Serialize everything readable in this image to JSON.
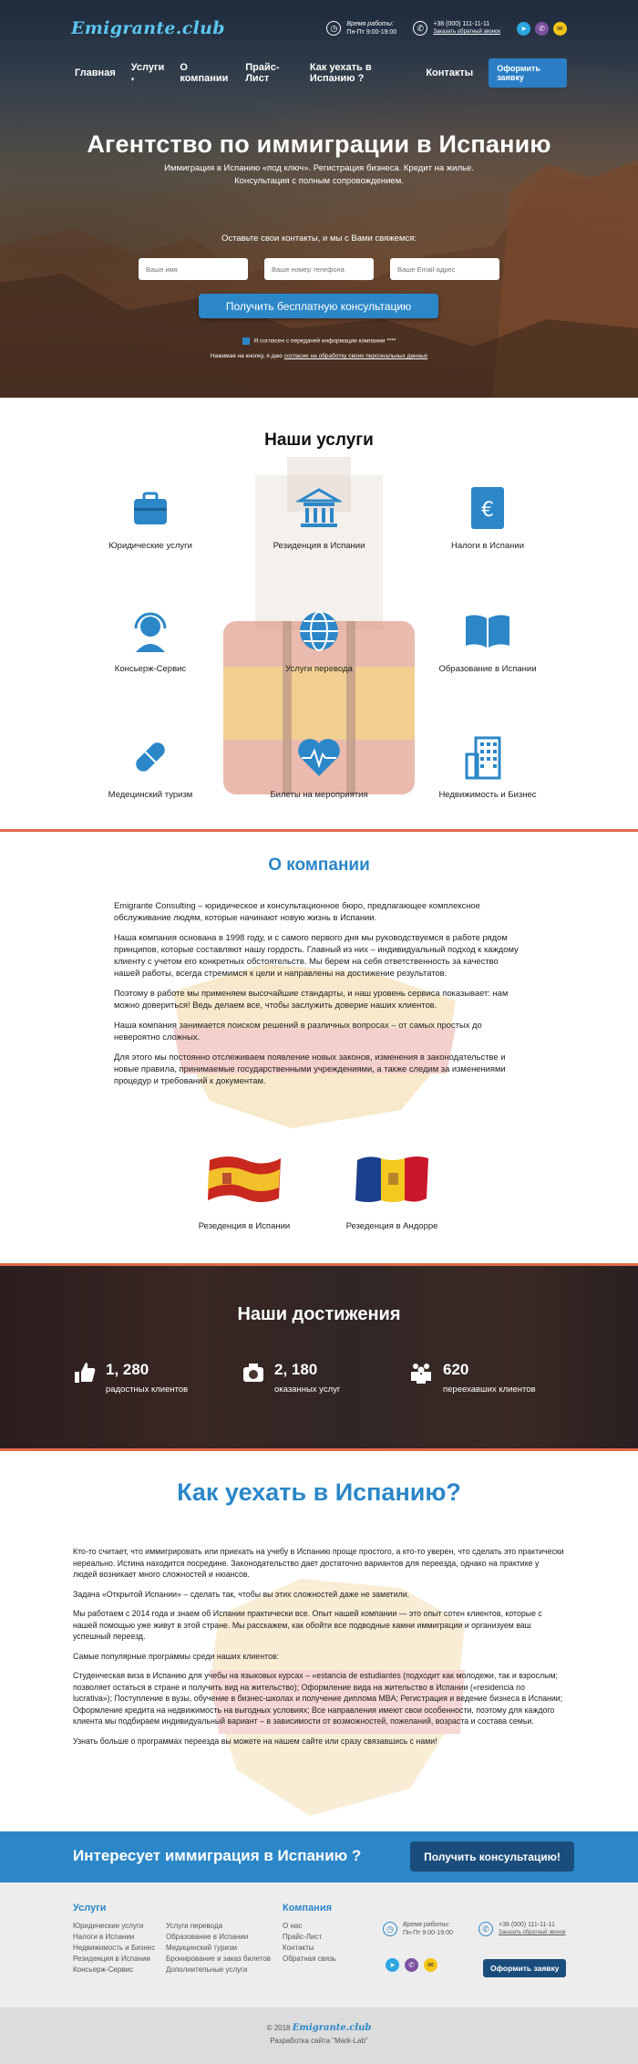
{
  "header": {
    "logo": "Emigrante.club",
    "hours_label": "Время работы:",
    "hours_value": "Пн-Пт 9:00-19:00",
    "phone": "+38 (000) 111-11-11",
    "callback": "Заказать обратный звонок",
    "nav": [
      "Главная",
      "Услуги",
      "О компании",
      "Прайс-Лист",
      "Как уехать в Испанию ?",
      "Контакты"
    ],
    "order_button": "Оформить заявку"
  },
  "hero": {
    "title": "Агентство по иммиграции в Испанию",
    "subtitle": "Иммиграция в Испанию «под ключ». Регистрация бизнеса. Кредит на жилье. Консультация с полным сопровождением.",
    "leave_contacts": "Оставьте свои контакты, и мы с Вами свяжемся:",
    "name_placeholder": "Ваше имя",
    "phone_placeholder": "Ваше номер телефона",
    "email_placeholder": "Ваше Email-адрес",
    "cta": "Получить бесплатную консультацию",
    "agree": "Я согласен с передачей информации компании ****",
    "agree2_prefix": "Нажимая на кнопку, я даю",
    "agree2_link": "согласие на обработку своих персональных данных"
  },
  "services": {
    "title": "Наши услуги",
    "items": [
      {
        "label": "Юридические услуги",
        "icon": "briefcase-icon"
      },
      {
        "label": "Резиденция в Испании",
        "icon": "building-icon"
      },
      {
        "label": "Налоги в Испании",
        "icon": "euro-doc-icon"
      },
      {
        "label": "Консьерж-Сервис",
        "icon": "headset-icon"
      },
      {
        "label": "Услуги перевода",
        "icon": "globe-icon"
      },
      {
        "label": "Образование в Испании",
        "icon": "book-icon"
      },
      {
        "label": "Медецинский туризм",
        "icon": "pill-icon"
      },
      {
        "label": "Билеты на мероприятия",
        "icon": "heartbeat-icon"
      },
      {
        "label": "Недвижимость и Бизнес",
        "icon": "office-icon"
      }
    ]
  },
  "about": {
    "title": "О компании",
    "paragraphs": [
      "Emigrante Consulting – юридическое и консультационное бюро, предлагающее комплексное обслуживание людям, которые начинают новую жизнь в Испании.",
      "Наша компания основана в 1998 году, и с самого первого дня мы руководствуемся в работе рядом принципов, которые составляют нашу гордость. Главный из них – индивидуальный подход к каждому клиенту с учетом его конкретных обстоятельств. Мы берем на себя ответственность за качество нашей работы, всегда стремимся к цели и направлены на достижение результатов.",
      "Поэтому в работе мы применяем высочайшие стандарты, и наш уровень сервиса показывает: нам можно довериться! Ведь делаем все, чтобы заслужить доверие наших клиентов.",
      "Наша компания занимается поиском решений в различных вопросах – от самых простых до невероятно сложных.",
      "Для этого мы постоянно отслеживаем появление новых законов, изменения в законодательстве и новые правила, принимаемые государственными учреждениями, а также следим за изменениями процедур и требований к документам."
    ],
    "flags": [
      "Резеденция в Испании",
      "Резеденция в Андорре"
    ]
  },
  "achievements": {
    "title": "Наши достижения",
    "stats": [
      {
        "num": "1, 280",
        "label": "радостных клиентов"
      },
      {
        "num": "2, 180",
        "label": "оказанных услуг"
      },
      {
        "num": "620",
        "label": "переехавших клиентов"
      }
    ]
  },
  "howto": {
    "title": "Как уехать в Испанию?",
    "paragraphs": [
      "Кто-то считает, что иммигрировать или приехать на учебу в Испанию проще простого, а кто-то уверен, что сделать это практически нереально. Истина находится посредине. Законодательство дает достаточно вариантов для переезда, однако на практике у людей возникает много сложностей и нюансов.",
      "Задача «Открытой Испании» – сделать так, чтобы вы этих сложностей даже не заметили.",
      "Мы работаем с 2014 года и знаем об Испании практически все. Опыт нашей компании — это опыт сотен клиентов, которые с нашей помощью уже живут в этой стране. Мы расскажем, как обойти все подводные камни иммиграции и организуем ваш успешный переезд.",
      "Самые популярные программы среди наших клиентов:",
      "Студенческая виза в Испанию для учебы на языковых курсах – «estancia de estudiantes (подходит как молодежи, так и взрослым; позволяет остаться в стране и получить вид на жительство); Оформление вида на жительство в Испании («residencia no lucrativa»); Поступление в вузы, обучение в бизнес-школах и получение диплома MBA; Регистрация и ведение бизнеса в Испании; Оформление кредита на недвижимость на выгодных условиях; Все направления имеют свои особенности, поэтому для каждого клиента мы подбираем индивидуальный вариант – в зависимости от возможностей, пожеланий, возраста и состава семьи.",
      "Узнать больше о программах переезда вы можете на нашем сайте или сразу связавшись с нами!"
    ]
  },
  "banner": {
    "text": "Интересует иммиграция в Испанию ?",
    "button": "Получить консультацию!"
  },
  "footer": {
    "services_title": "Услуги",
    "services_col1": [
      "Юридические услуги",
      "Налоги в Испании",
      "Недвижимость и Бизнес",
      "Резиденция в Испании",
      "Консьерж-Сервис"
    ],
    "services_col2": [
      "Услуги перевода",
      "Образование в Испании",
      "Медицинский туризм",
      "Бронирование и заказ билетов",
      "Дополнительные услуги"
    ],
    "company_title": "Компания",
    "company_items": [
      "О нас",
      "Прайс-Лист",
      "Контакты",
      "Обратная связь"
    ],
    "hours_label": "Время работы:",
    "hours_value": "Пн-Пт 9:00-19:00",
    "phone": "+38 (000) 111-11-11",
    "callback": "Заказать обратный звонок",
    "order_button": "Оформить заявку",
    "copyright_year": "© 2018",
    "copyright_logo": "Emigrante.club",
    "dev": "Разработка сайта \"Mark-Lab\""
  },
  "colors": {
    "accent": "#2b87c8",
    "dark": "#1b4d7c",
    "divider": "#e06a48"
  }
}
